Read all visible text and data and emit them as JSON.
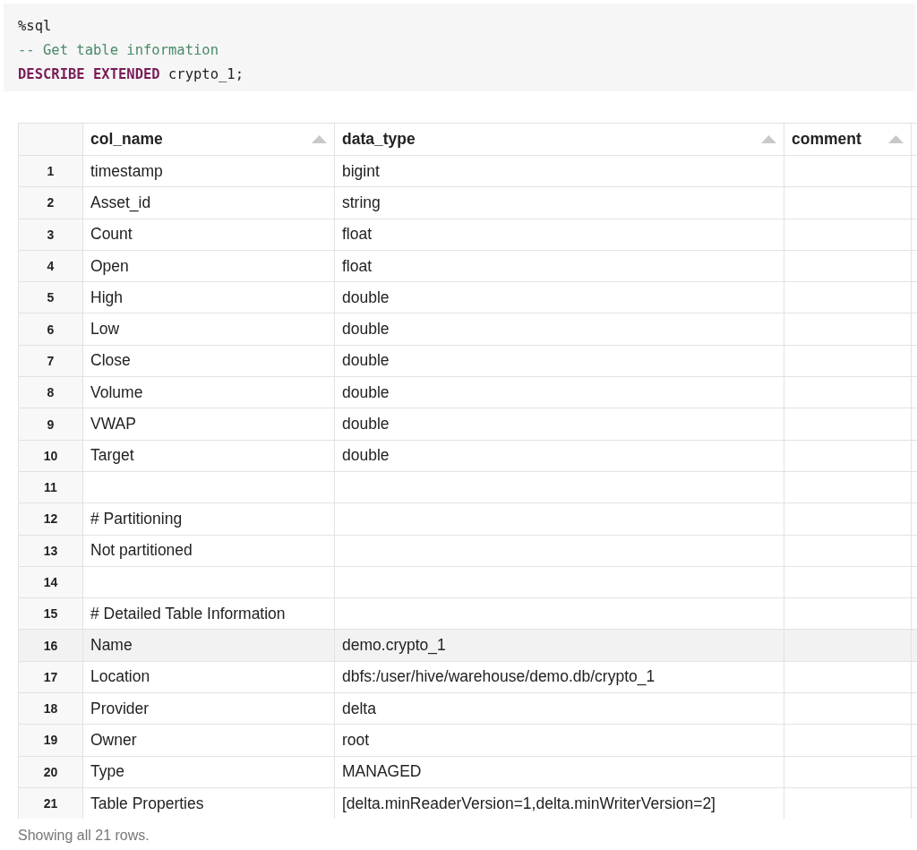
{
  "code": {
    "lines": [
      [
        {
          "kind": "plain",
          "text": "%sql"
        }
      ],
      [
        {
          "kind": "comment",
          "text": "-- Get table information"
        }
      ],
      [
        {
          "kind": "keyword",
          "text": "DESCRIBE EXTENDED"
        },
        {
          "kind": "plain",
          "text": " crypto_1;"
        }
      ]
    ]
  },
  "table": {
    "columns": [
      {
        "label": "col_name"
      },
      {
        "label": "data_type"
      },
      {
        "label": "comment"
      }
    ],
    "rows": [
      {
        "index": "1",
        "cells": [
          "timestamp",
          "bigint",
          ""
        ],
        "selected": false
      },
      {
        "index": "2",
        "cells": [
          "Asset_id",
          "string",
          ""
        ],
        "selected": false
      },
      {
        "index": "3",
        "cells": [
          "Count",
          "float",
          ""
        ],
        "selected": false
      },
      {
        "index": "4",
        "cells": [
          "Open",
          "float",
          ""
        ],
        "selected": false
      },
      {
        "index": "5",
        "cells": [
          "High",
          "double",
          ""
        ],
        "selected": false
      },
      {
        "index": "6",
        "cells": [
          "Low",
          "double",
          ""
        ],
        "selected": false
      },
      {
        "index": "7",
        "cells": [
          "Close",
          "double",
          ""
        ],
        "selected": false
      },
      {
        "index": "8",
        "cells": [
          "Volume",
          "double",
          ""
        ],
        "selected": false
      },
      {
        "index": "9",
        "cells": [
          "VWAP",
          "double",
          ""
        ],
        "selected": false
      },
      {
        "index": "10",
        "cells": [
          "Target",
          "double",
          ""
        ],
        "selected": false
      },
      {
        "index": "11",
        "cells": [
          "",
          "",
          ""
        ],
        "selected": false
      },
      {
        "index": "12",
        "cells": [
          "# Partitioning",
          "",
          ""
        ],
        "selected": false
      },
      {
        "index": "13",
        "cells": [
          "Not partitioned",
          "",
          ""
        ],
        "selected": false
      },
      {
        "index": "14",
        "cells": [
          "",
          "",
          ""
        ],
        "selected": false
      },
      {
        "index": "15",
        "cells": [
          "# Detailed Table Information",
          "",
          ""
        ],
        "selected": false
      },
      {
        "index": "16",
        "cells": [
          "Name",
          "demo.crypto_1",
          ""
        ],
        "selected": true
      },
      {
        "index": "17",
        "cells": [
          "Location",
          "dbfs:/user/hive/warehouse/demo.db/crypto_1",
          ""
        ],
        "selected": false
      },
      {
        "index": "18",
        "cells": [
          "Provider",
          "delta",
          ""
        ],
        "selected": false
      },
      {
        "index": "19",
        "cells": [
          "Owner",
          "root",
          ""
        ],
        "selected": false
      },
      {
        "index": "20",
        "cells": [
          "Type",
          "MANAGED",
          ""
        ],
        "selected": false
      },
      {
        "index": "21",
        "cells": [
          "Table Properties",
          "[delta.minReaderVersion=1,delta.minWriterVersion=2]",
          ""
        ],
        "selected": false
      }
    ]
  },
  "footer": "Showing all 21 rows."
}
